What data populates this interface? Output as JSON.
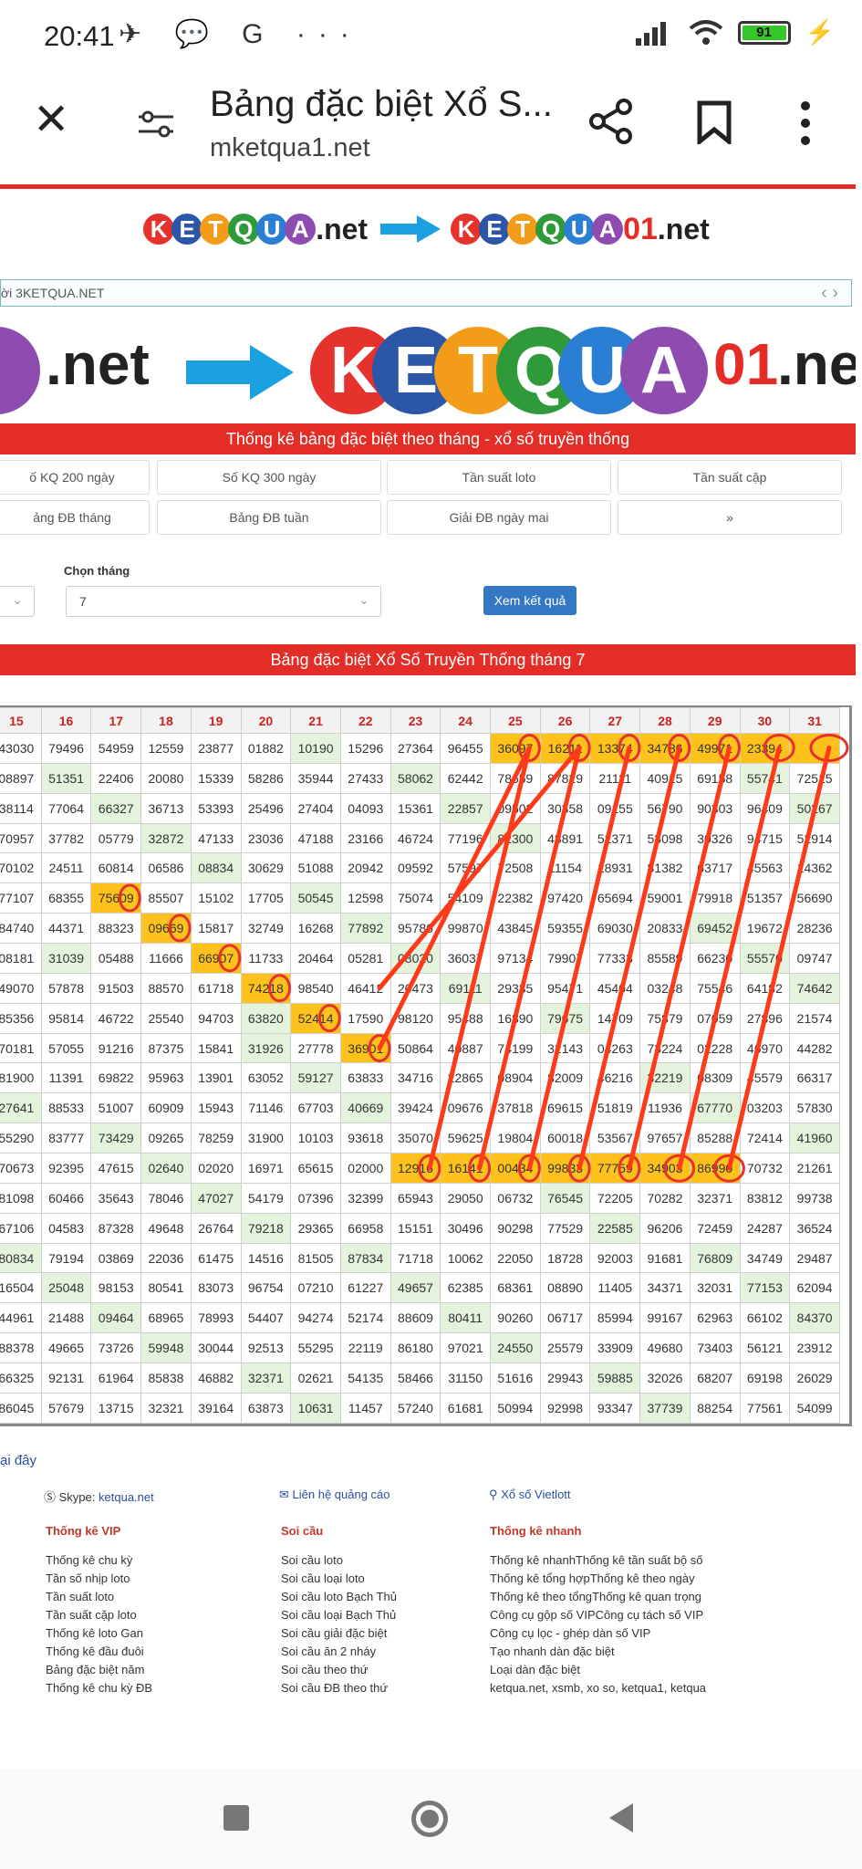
{
  "status": {
    "time": "20:41",
    "left_icons": "✈ 💬 G ···",
    "battery": "91"
  },
  "browser": {
    "title": "Bảng đặc biệt Xổ S...",
    "url": "mketqua1.net"
  },
  "logo": {
    "old_letters": [
      "K",
      "E",
      "T",
      "Q",
      "U",
      "A"
    ],
    "old_suffix": ".net",
    "new_digits": "01",
    "new_suffix": ".net",
    "ball_colors": [
      "#e5322d",
      "#2c56a8",
      "#f39c1a",
      "#2f9a3a",
      "#2a7fd4",
      "#8e4bb0"
    ],
    "arrow_color": "#1ba1e2",
    "red": "#e52d27"
  },
  "address_text": "ời 3KETQUA.NET",
  "big_logo_partial": ".net",
  "section1_title": "Thống kê bảng đặc biệt theo tháng - xổ số truyền thống",
  "buttons_row1": [
    "ố KQ 200 ngày",
    "Số KQ 300 ngày",
    "Tần suất loto",
    "Tần suất cặp"
  ],
  "buttons_row2": [
    "ảng ĐB tháng",
    "Bảng ĐB tuần",
    "Giải ĐB ngày mai",
    "»"
  ],
  "form": {
    "month_label": "Chọn tháng",
    "month_value": "7",
    "submit": "Xem kết quả"
  },
  "section2_title": "Bảng đặc biệt Xổ Số Truyền Thống tháng 7",
  "table": {
    "headers": [
      "15",
      "16",
      "17",
      "18",
      "19",
      "20",
      "21",
      "22",
      "23",
      "24",
      "25",
      "26",
      "27",
      "28",
      "29",
      "30",
      "31"
    ],
    "rows": [
      [
        "43030",
        "79496",
        "54959",
        "12559",
        "23877",
        "01882",
        "10190",
        "15296",
        "27364",
        "96455",
        "36097",
        "16211",
        "13374",
        "34786",
        "49971",
        "23394",
        ""
      ],
      [
        "08897",
        "51351",
        "22406",
        "20080",
        "15339",
        "58286",
        "35944",
        "27433",
        "58062",
        "62442",
        "78659",
        "87829",
        "21111",
        "40915",
        "69158",
        "55741",
        "72515"
      ],
      [
        "38114",
        "77064",
        "66327",
        "36713",
        "53393",
        "25496",
        "27404",
        "04093",
        "15361",
        "22857",
        "09502",
        "30358",
        "09155",
        "56790",
        "90303",
        "96409",
        "50267"
      ],
      [
        "70957",
        "37782",
        "05779",
        "32872",
        "47133",
        "23036",
        "47188",
        "23166",
        "46724",
        "77196",
        "82300",
        "48891",
        "52371",
        "53098",
        "30326",
        "94715",
        "52914"
      ],
      [
        "70102",
        "24511",
        "60814",
        "06586",
        "08834",
        "30629",
        "51088",
        "20942",
        "09592",
        "57597",
        "72508",
        "11154",
        "18931",
        "81382",
        "63717",
        "45563",
        "14362"
      ],
      [
        "77107",
        "68355",
        "75609",
        "85507",
        "15102",
        "17705",
        "50545",
        "12598",
        "75074",
        "54109",
        "22382",
        "97420",
        "65694",
        "59001",
        "79918",
        "51357",
        "56690"
      ],
      [
        "84740",
        "44371",
        "88323",
        "09669",
        "15817",
        "32749",
        "16268",
        "77892",
        "95786",
        "99870",
        "43845",
        "59355",
        "69030",
        "20833",
        "69452",
        "19672",
        "28236"
      ],
      [
        "08181",
        "31039",
        "05488",
        "11666",
        "66907",
        "11733",
        "20464",
        "05281",
        "08020",
        "36037",
        "97134",
        "79907",
        "77333",
        "85589",
        "66230",
        "55570",
        "09747"
      ],
      [
        "49070",
        "57878",
        "91503",
        "88570",
        "61718",
        "74218",
        "98540",
        "46412",
        "20473",
        "69111",
        "29335",
        "95471",
        "45404",
        "03248",
        "75546",
        "64182",
        "74642"
      ],
      [
        "85356",
        "95814",
        "46722",
        "25540",
        "94703",
        "63820",
        "52414",
        "17590",
        "98120",
        "95488",
        "16890",
        "79675",
        "14709",
        "75879",
        "07059",
        "27896",
        "21574"
      ],
      [
        "70181",
        "57055",
        "91216",
        "87375",
        "15841",
        "31926",
        "27778",
        "36901",
        "50864",
        "40887",
        "74199",
        "32143",
        "04263",
        "73224",
        "02228",
        "46970",
        "44282"
      ],
      [
        "81900",
        "11391",
        "69822",
        "95963",
        "13901",
        "63052",
        "59127",
        "63833",
        "34716",
        "22865",
        "08904",
        "82009",
        "46216",
        "32219",
        "08309",
        "45579",
        "66317"
      ],
      [
        "27641",
        "88533",
        "51007",
        "60909",
        "15943",
        "71146",
        "67703",
        "40669",
        "39424",
        "09676",
        "37818",
        "69615",
        "51819",
        "11936",
        "67770",
        "03203",
        "57830"
      ],
      [
        "55290",
        "83777",
        "73429",
        "09265",
        "78259",
        "31900",
        "10103",
        "93618",
        "35070",
        "59625",
        "19804",
        "60018",
        "53567",
        "97657",
        "85288",
        "72414",
        "41960"
      ],
      [
        "70673",
        "92395",
        "47615",
        "02640",
        "02020",
        "16971",
        "65615",
        "02000",
        "12916",
        "16141",
        "00434",
        "99833",
        "77759",
        "34903",
        "86990",
        "70732",
        "21261"
      ],
      [
        "81098",
        "60466",
        "35643",
        "78046",
        "47027",
        "54179",
        "07396",
        "32399",
        "65943",
        "29050",
        "06732",
        "76545",
        "72205",
        "70282",
        "32371",
        "83812",
        "99738"
      ],
      [
        "67106",
        "04583",
        "87328",
        "49648",
        "26764",
        "79218",
        "29365",
        "66958",
        "15151",
        "30496",
        "90298",
        "77529",
        "22585",
        "96206",
        "72459",
        "24287",
        "36524"
      ],
      [
        "80834",
        "79194",
        "03869",
        "22036",
        "61475",
        "14516",
        "81505",
        "87834",
        "71718",
        "10062",
        "22050",
        "18728",
        "92003",
        "91681",
        "76809",
        "34749",
        "29487"
      ],
      [
        "16504",
        "25048",
        "98153",
        "80541",
        "83073",
        "96754",
        "07210",
        "61227",
        "49657",
        "62385",
        "68361",
        "08890",
        "11405",
        "34371",
        "32031",
        "77153",
        "62094"
      ],
      [
        "44961",
        "21488",
        "09464",
        "68965",
        "78993",
        "54407",
        "94274",
        "52174",
        "88609",
        "80411",
        "90260",
        "06717",
        "85994",
        "99167",
        "62963",
        "66102",
        "84370"
      ],
      [
        "88378",
        "49665",
        "73726",
        "59948",
        "30044",
        "92513",
        "55295",
        "22119",
        "86180",
        "97021",
        "24550",
        "25579",
        "33909",
        "49680",
        "73403",
        "56121",
        "23912"
      ],
      [
        "66325",
        "92131",
        "61964",
        "85838",
        "46882",
        "32371",
        "02621",
        "54135",
        "58466",
        "31150",
        "51616",
        "29943",
        "59885",
        "32026",
        "68207",
        "69198",
        "26029"
      ],
      [
        "86045",
        "57679",
        "13715",
        "32321",
        "39164",
        "63873",
        "10631",
        "11457",
        "57240",
        "61681",
        "50994",
        "92998",
        "93347",
        "37739",
        "88254",
        "77561",
        "54099"
      ]
    ]
  },
  "below_link": "ại đây",
  "footer": {
    "skype_label": "Skype:",
    "skype_value": "ketqua.net",
    "ads": "Liên hệ quảng cáo",
    "vietlott": "Xổ số Vietlott",
    "col1_title": "Thống kê VIP",
    "col1": [
      "Thống kê chu kỳ",
      "Tần số nhịp loto",
      "Tần suất loto",
      "Tần suất cặp loto",
      "Thống kê loto Gan",
      "Thống kê đầu đuôi",
      "Bảng đặc biệt năm",
      "Thống kê chu kỳ ĐB"
    ],
    "col2_title": "Soi cầu",
    "col2": [
      "Soi cầu loto",
      "Soi cầu loại loto",
      "Soi cầu loto Bạch Thủ",
      "Soi cầu loại Bạch Thủ",
      "Soi cầu giải đặc biệt",
      "Soi cầu ăn 2 nháy",
      "Soi cầu theo thứ",
      "Soi cầu ĐB theo thứ"
    ],
    "col3_title": "Thống kê nhanh",
    "col3": [
      "Thống kê nhanhThống kê tần suất bộ số",
      "Thống kê tổng hợpThống kê theo ngày",
      "Thống kê theo tổngThống kê quan trọng",
      "Công cụ gộp số VIPCông cụ tách số VIP",
      "Công cụ lọc - ghép dàn số VIP",
      "Tạo nhanh dàn đặc biệt",
      "Loại dàn đặc biệt",
      "ketqua.net, xsmb, xo so, ketqua1, ketqua"
    ]
  }
}
